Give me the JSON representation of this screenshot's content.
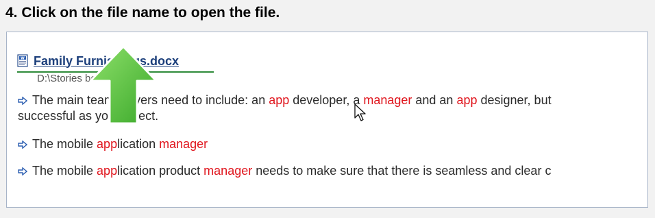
{
  "instruction": {
    "title": "4. Click on the file name to open the file."
  },
  "result": {
    "file_name": "Family Furnishings.docx",
    "file_path": "D:\\Stories best",
    "icon": "word-document-icon",
    "snippets": [
      {
        "bullet_icon": "blue-arrow-bullet-icon",
        "line1": [
          {
            "t": "The main team players need to include: an "
          },
          {
            "t": "app",
            "hl": true
          },
          {
            "t": " developer, a "
          },
          {
            "t": "manager",
            "hl": true
          },
          {
            "t": " and an "
          },
          {
            "t": "app",
            "hl": true
          },
          {
            "t": " designer, but"
          }
        ],
        "line2": [
          {
            "t": "successful as you expect."
          }
        ]
      },
      {
        "bullet_icon": "blue-arrow-bullet-icon",
        "line1": [
          {
            "t": "The mobile "
          },
          {
            "t": "app",
            "hl": true
          },
          {
            "t": "lication "
          },
          {
            "t": "manager",
            "hl": true
          }
        ]
      },
      {
        "bullet_icon": "blue-arrow-bullet-icon",
        "line1": [
          {
            "t": "The mobile "
          },
          {
            "t": "app",
            "hl": true
          },
          {
            "t": "lication product "
          },
          {
            "t": "manager",
            "hl": true
          },
          {
            "t": " needs to make sure that there is seamless and clear c"
          }
        ]
      }
    ]
  },
  "colors": {
    "highlight": "#e0141c",
    "link": "#1c3f7b",
    "underline_annotation": "#2e8b3a",
    "arrow_annotation": "#58c43a",
    "panel_border": "#a7b4c8"
  },
  "overlay": {
    "arrow_icon": "green-up-arrow-icon",
    "cursor_icon": "mouse-pointer-icon"
  }
}
